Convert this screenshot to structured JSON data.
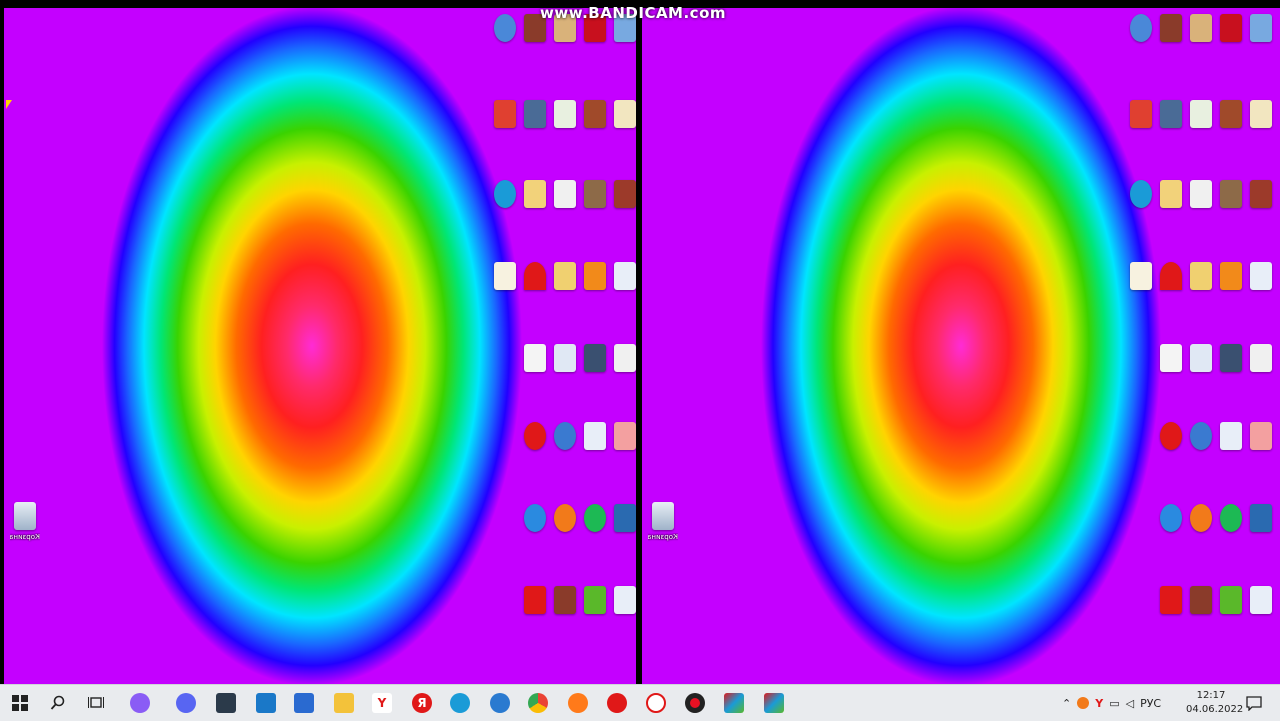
{
  "watermark": "www.BANDICAM.com",
  "recycle_bin_label": "Корзина",
  "taskbar": {
    "lang": "РУС",
    "time": "12:17",
    "date": "04.06.2022"
  },
  "colors": {
    "taskbar_bg": "#e9ebee",
    "accent_red": "#e81123"
  }
}
